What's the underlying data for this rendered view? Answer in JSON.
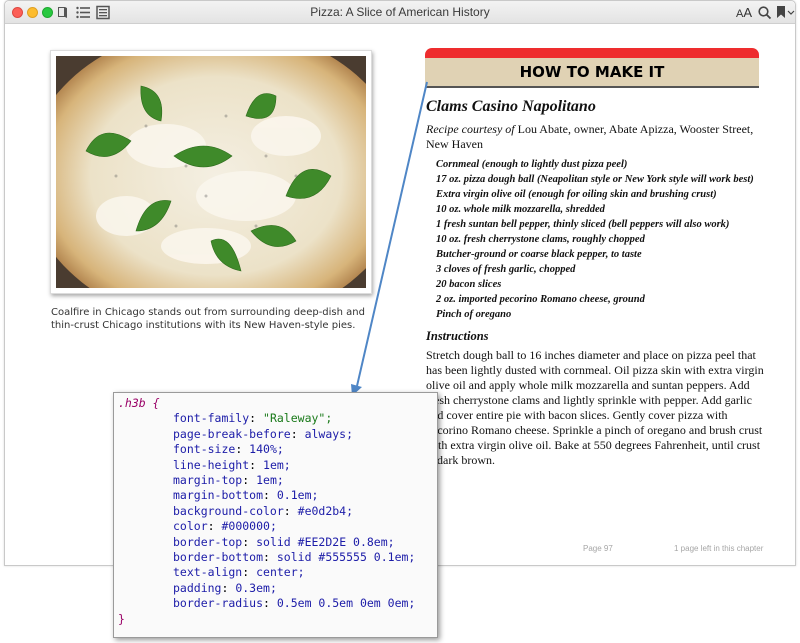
{
  "window": {
    "title": "Pizza: A Slice of American History"
  },
  "toolbar": {
    "font_size_label_small": "A",
    "font_size_label_large": "A"
  },
  "left": {
    "caption": "Coalfire in Chicago stands out from surrounding deep-dish and thin-crust Chicago institutions with its New Haven-style pies."
  },
  "right": {
    "banner": "HOW TO MAKE IT",
    "recipe_title": "Clams Casino Napolitano",
    "courtesy_label": "Recipe courtesy of",
    "courtesy_text": " Lou Abate, owner, Abate Apizza, Wooster Street, New Haven",
    "ingredients": [
      "Cornmeal (enough to lightly dust pizza peel)",
      "17 oz. pizza dough ball (Neapolitan style or New York style will work best)",
      "Extra virgin olive oil (enough for oiling skin and brushing crust)",
      "10 oz. whole milk mozzarella, shredded",
      "1 fresh suntan bell pepper, thinly sliced (bell peppers will also work)",
      "10 oz. fresh cherrystone clams, roughly chopped",
      "Butcher-ground or coarse black pepper, to taste",
      "3 cloves of fresh garlic, chopped",
      "20 bacon slices",
      "2 oz. imported pecorino Romano cheese, ground",
      "Pinch of oregano"
    ],
    "instructions_heading": "Instructions",
    "instructions_text": "Stretch dough ball to 16 inches diameter and place on pizza peel that has been lightly dusted with cornmeal. Oil pizza skin with extra virgin olive oil and apply whole milk mozzarella and suntan peppers. Add fresh cherrystone clams and lightly sprinkle with pepper. Add garlic and cover entire pie with bacon slices. Gently cover pizza with pecorino Romano cheese. Sprinkle a pinch of oregano and brush crust with extra virgin olive oil. Bake at 550 degrees Fahrenheit, until crust is dark brown.",
    "page_number": "Page 97",
    "pages_left": "1 page left in this chapter"
  },
  "code": {
    "selector": ".h3b {",
    "lines": [
      {
        "prop": "font-family",
        "value": "\"Raleway\";"
      },
      {
        "prop": "page-break-before",
        "value": "always;"
      },
      {
        "prop": "font-size",
        "value": "140%;"
      },
      {
        "prop": "line-height",
        "value": "1em;"
      },
      {
        "prop": "margin-top",
        "value": "1em;"
      },
      {
        "prop": "margin-bottom",
        "value": "0.1em;"
      },
      {
        "prop": "background-color",
        "value": "#e0d2b4;"
      },
      {
        "prop": "color",
        "value": "#000000;"
      },
      {
        "prop": "border-top",
        "value": "solid #EE2D2E 0.8em;"
      },
      {
        "prop": "border-bottom",
        "value": "solid #555555 0.1em;"
      },
      {
        "prop": "text-align",
        "value": "center;"
      },
      {
        "prop": "padding",
        "value": "0.3em;"
      },
      {
        "prop": "border-radius",
        "value": "0.5em 0.5em 0em 0em;"
      }
    ],
    "closing": "}"
  },
  "colors": {
    "banner_bg": "#e0d2b4",
    "banner_top": "#EE2D2E",
    "banner_bottom": "#555555",
    "arrow": "#4f86c6"
  },
  "icons": [
    "book-icon",
    "list-icon",
    "notes-icon",
    "search-icon",
    "bookmark-icon",
    "chevron-down-icon"
  ]
}
